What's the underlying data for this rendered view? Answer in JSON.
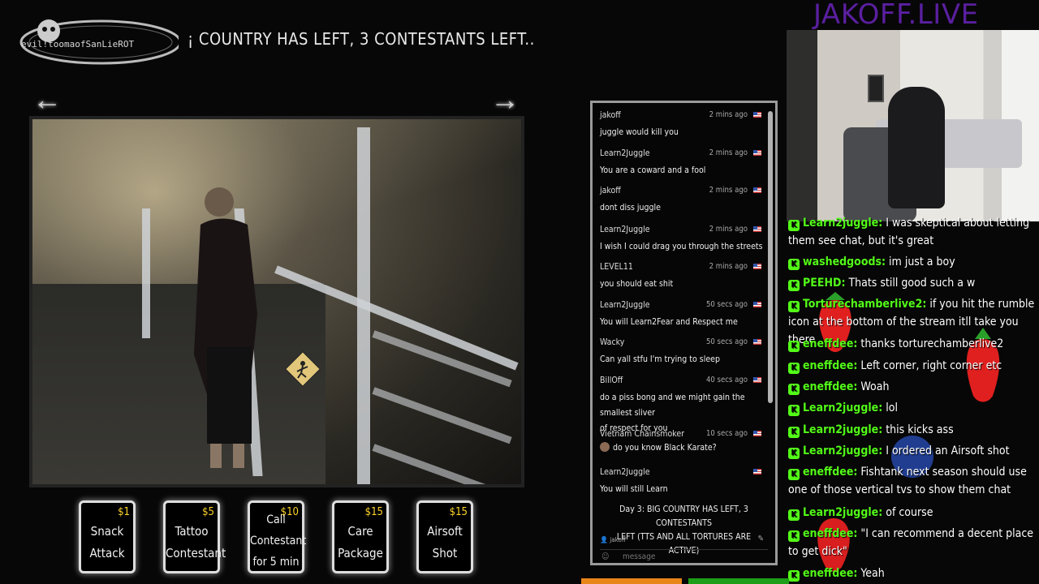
{
  "logo": {
    "text": "evil!toomaofSanLieROT"
  },
  "ticker": {
    "text": "¡ COUNTRY HAS LEFT, 3 CONTESTANTS LEFT.."
  },
  "site_title": "JAKOFF.LIVE",
  "nav": {
    "prev_icon": "arrow-left-icon",
    "next_icon": "arrow-right-icon"
  },
  "tip_buttons": [
    {
      "price": "$1",
      "line1": "Snack",
      "line2": "Attack"
    },
    {
      "price": "$5",
      "line1": "Tattoo",
      "line2": "Contestant"
    },
    {
      "price": "$10",
      "line1": "Call",
      "line2": "Contestant",
      "line3": "for 5 min"
    },
    {
      "price": "$15",
      "line1": "Care",
      "line2": "Package"
    },
    {
      "price": "$15",
      "line1": "Airsoft",
      "line2": "Shot"
    }
  ],
  "chat": {
    "messages": [
      {
        "user": "jakoff",
        "time": "2 mins ago",
        "text": "juggle would kill you"
      },
      {
        "user": "Learn2Juggle",
        "time": "2 mins ago",
        "text": "You are a coward and a fool"
      },
      {
        "user": "jakoff",
        "time": "2 mins ago",
        "text": "dont diss juggle"
      },
      {
        "user": "Learn2Juggle",
        "time": "2 mins ago",
        "text": "I wish I could drag you through the streets"
      },
      {
        "user": "LEVEL11",
        "time": "2 mins ago",
        "text": "you should eat shit"
      },
      {
        "user": "Learn2Juggle",
        "time": "50 secs ago",
        "text": "You will Learn2Fear and Respect me"
      },
      {
        "user": "Wacky",
        "time": "50 secs ago",
        "text": "Can yall stfu I'm trying to sleep"
      },
      {
        "user": "BillOff",
        "time": "40 secs ago",
        "text": "do a piss bong and we might gain the smallest sliver",
        "text2": "of respect for you"
      },
      {
        "user": "Vietnam Chainsmoker",
        "time": "10 secs ago",
        "text": "do you know Black Karate?"
      },
      {
        "user": "Learn2Juggle",
        "time": "",
        "text": "You will still Learn"
      }
    ],
    "announcement_line1": "Day 3: BIG COUNTRY HAS LEFT, 3 CONTESTANTS",
    "announcement_line2": "LEFT (TTS AND ALL TORTURES ARE ACTIVE)",
    "me": "jakoff",
    "placeholder": "message"
  },
  "right_chat": [
    {
      "user": "Learn2juggle:",
      "text": " I was skeptical about letting them see chat, but it's great"
    },
    {
      "user": "washedgoods:",
      "text": " im just a boy"
    },
    {
      "user": "PEEHD:",
      "text": " Thats still good such a w"
    },
    {
      "user": "Torturechamberlive2:",
      "text": " if you hit the rumble icon at the bottom of the stream itll take you there"
    },
    {
      "user": "eneffdee:",
      "text": " thanks torturechamberlive2"
    },
    {
      "user": "eneffdee:",
      "text": " Left corner, right corner etc"
    },
    {
      "user": "eneffdee:",
      "text": " Woah"
    },
    {
      "user": "Learn2juggle:",
      "text": " lol"
    },
    {
      "user": "Learn2juggle:",
      "text": " this kicks ass"
    },
    {
      "user": "Learn2juggle:",
      "text": " I ordered an Airsoft shot"
    },
    {
      "user": "eneffdee:",
      "text": " Fishtank next season should use one of those vertical tvs to show them chat"
    },
    {
      "user": "Learn2juggle:",
      "text": " of course"
    },
    {
      "user": "eneffdee:",
      "text": " \"I can recommend a decent place to get dick\""
    },
    {
      "user": "eneffdee:",
      "text": " Yeah"
    }
  ],
  "colors": {
    "accent_green": "#53fc18",
    "title_purple": "#5a1fa0",
    "price_yellow": "#ffd52a"
  }
}
